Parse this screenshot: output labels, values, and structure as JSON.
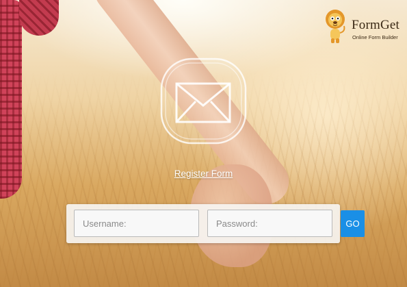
{
  "brand": {
    "name": "FormGet",
    "tagline": "Online Form Builder"
  },
  "icons": {
    "mail": "envelope-icon",
    "mascot": "lion-mascot-icon"
  },
  "form": {
    "title": "Register Form",
    "username_placeholder": "Username:",
    "password_placeholder": "Password:",
    "submit_label": "GO"
  },
  "colors": {
    "accent": "#1a8fe6",
    "field_bg": "#f8f8f8",
    "bar_bg": "#f6f4f1"
  }
}
